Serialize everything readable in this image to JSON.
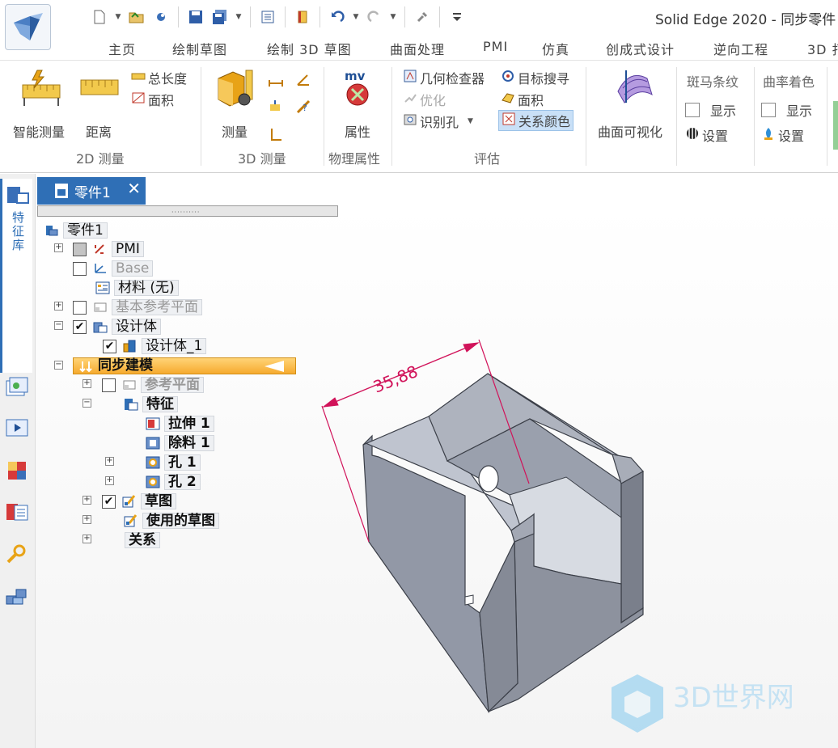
{
  "window": {
    "title": "Solid Edge 2020 - 同步零件"
  },
  "quick_access": {
    "icons": [
      "new-document-icon",
      "open-icon",
      "render-icon",
      "save-icon",
      "save-all-icon",
      "properties-icon",
      "book-icon",
      "undo-icon",
      "redo-icon",
      "tool-icon",
      "customize-icon"
    ]
  },
  "tabs": [
    "主页",
    "绘制草图",
    "绘制 3D 草图",
    "曲面处理",
    "PMI",
    "仿真",
    "创成式设计",
    "逆向工程",
    "3D 打"
  ],
  "ribbon": {
    "measure2d": {
      "smart_measure": "智能测量",
      "distance": "距离",
      "total_length": "总长度",
      "area": "面积",
      "group_label": "2D 测量"
    },
    "measure3d": {
      "measure": "测量",
      "group_label": "3D 测量"
    },
    "physical": {
      "properties": "属性",
      "icon_text": "mv",
      "group_label": "物理属性"
    },
    "evaluate": {
      "geometry_inspector": "几何检查器",
      "optimize": "优化",
      "recognize_holes": "识别孔",
      "target_seek": "目标搜寻",
      "area": "面积",
      "relationship_colors": "关系颜色",
      "group_label": "评估"
    },
    "surface_viz": {
      "label": "曲面可视化"
    },
    "zebra": {
      "title": "斑马条纹",
      "show": "显示",
      "settings": "设置"
    },
    "curvature": {
      "title": "曲率着色",
      "show": "显示",
      "settings": "设置"
    }
  },
  "left_strip": {
    "feature_library": "特征库"
  },
  "document": {
    "tab_title": "零件1",
    "close_glyph": "✕",
    "splitter_grip": "··········"
  },
  "tree": {
    "root": "零件1",
    "pmi": "PMI",
    "base": "Base",
    "material": "材料 (无)",
    "base_planes": "基本参考平面",
    "design_body": "设计体",
    "design_body_1": "设计体_1",
    "sync_modeling": "同步建模",
    "ref_planes": "参考平面",
    "features": "特征",
    "extrude": "拉伸 1",
    "cutout": "除料 1",
    "hole1": "孔 1",
    "hole2": "孔 2",
    "sketch": "草图",
    "used_sketches": "使用的草图",
    "relations": "关系"
  },
  "model": {
    "dimension": "35,88"
  },
  "watermark": {
    "text": "3D世界网"
  }
}
